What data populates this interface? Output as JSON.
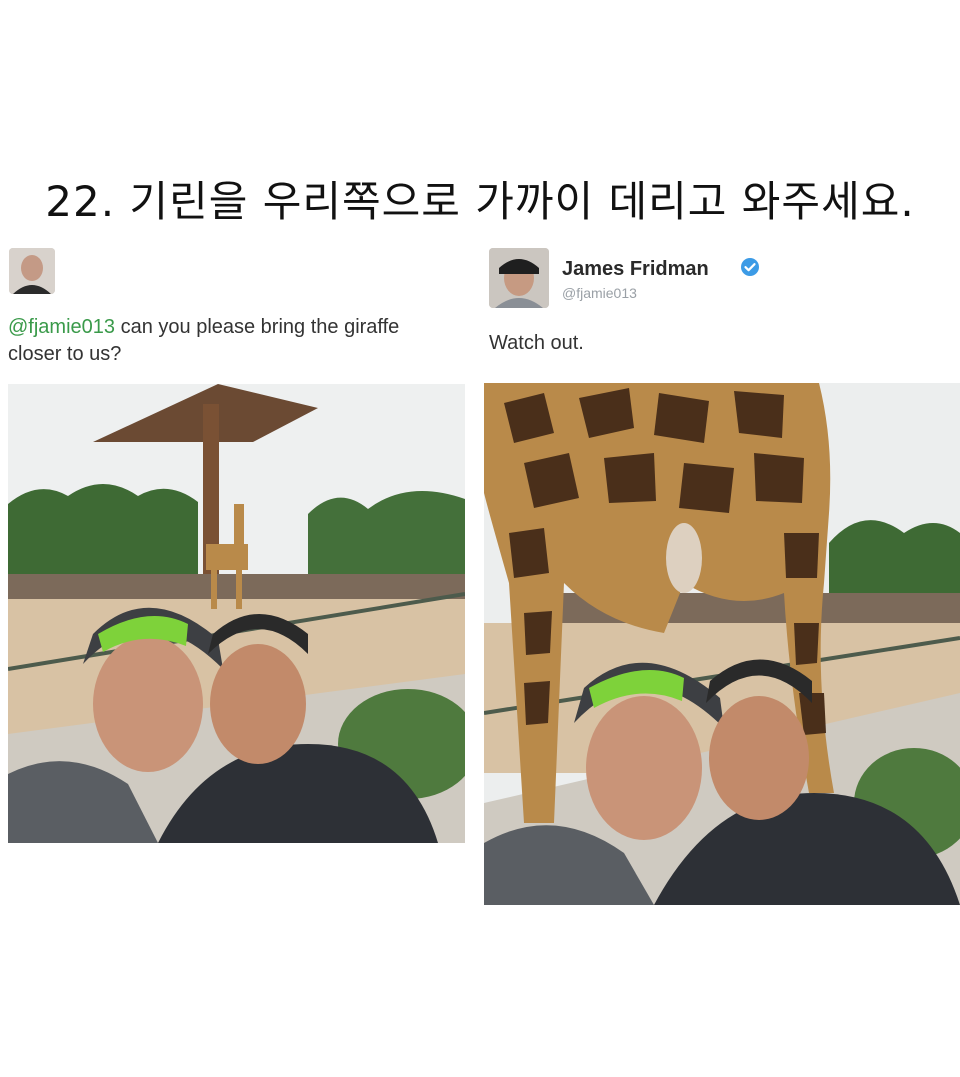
{
  "headline": "22. 기린을 우리쪽으로 가까이 데리고 와주세요.",
  "left_tweet": {
    "avatar_icon": "user-avatar",
    "mention": "@fjamie013",
    "text_line1": " can you please bring the giraffe",
    "text_line2": "closer to us?",
    "photo_icon": "selfie-photo-giraffe-background"
  },
  "right_tweet": {
    "avatar_icon": "user-avatar-cap",
    "author": "James Fridman",
    "verified_icon": "verified-badge-icon",
    "handle": "@fjamie013",
    "text": "Watch out.",
    "photo_icon": "edited-photo-giraffe-foreground"
  },
  "colors": {
    "mention": "#3a9a4a",
    "verified": "#3c9be6",
    "sky": "#eceeee",
    "ground": "#d8c2a4",
    "foliage": "#3e6a34",
    "giraffe": "#b98a4a",
    "giraffe_spot": "#4a2f1a",
    "cap_green": "#7ed23a",
    "shirt": "#2d3036"
  }
}
